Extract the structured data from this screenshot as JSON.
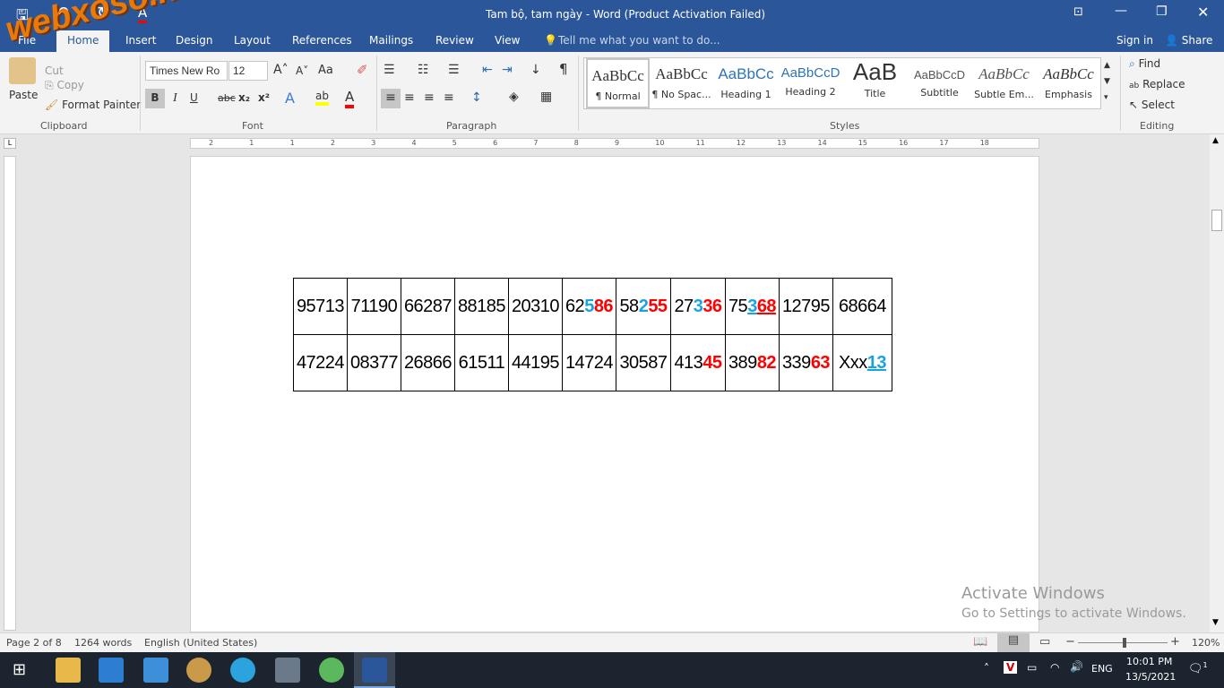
{
  "titlebar": {
    "title": "Tam bộ, tam ngày - Word (Product Activation Failed)",
    "save_icon": "save-icon",
    "undo_icon": "undo-icon",
    "redo_icon": "redo-icon"
  },
  "tabs": [
    {
      "label": "File"
    },
    {
      "label": "Home"
    },
    {
      "label": "Insert"
    },
    {
      "label": "Design"
    },
    {
      "label": "Layout"
    },
    {
      "label": "References"
    },
    {
      "label": "Mailings"
    },
    {
      "label": "Review"
    },
    {
      "label": "View"
    }
  ],
  "tell_me": "Tell me what you want to do...",
  "sign_in": "Sign in",
  "share": "Share",
  "clipboard": {
    "paste": "Paste",
    "cut": "Cut",
    "copy": "Copy",
    "format_painter": "Format Painter",
    "label": "Clipboard"
  },
  "font": {
    "name": "Times New Ro",
    "size": "12",
    "label": "Font",
    "aa": "Aa",
    "bold": "B",
    "italic": "I",
    "underline": "U",
    "strike": "abc",
    "sub": "x₂",
    "sup": "x²"
  },
  "paragraph": {
    "label": "Paragraph",
    "pilcrow": "¶"
  },
  "styles": {
    "label": "Styles",
    "items": [
      {
        "preview": "AaBbCc",
        "name": "¶ Normal"
      },
      {
        "preview": "AaBbCc",
        "name": "¶ No Spac..."
      },
      {
        "preview": "AaBbCc",
        "name": "Heading 1"
      },
      {
        "preview": "AaBbCcD",
        "name": "Heading 2"
      },
      {
        "preview": "AaB",
        "name": "Title"
      },
      {
        "preview": "AaBbCcD",
        "name": "Subtitle"
      },
      {
        "preview": "AaBbCc",
        "name": "Subtle Em..."
      },
      {
        "preview": "AaBbCc",
        "name": "Emphasis"
      }
    ]
  },
  "editing": {
    "label": "Editing",
    "find": "Find",
    "replace": "Replace",
    "select": "Select"
  },
  "ruler": {
    "marks": [
      "2",
      "1",
      "1",
      "2",
      "3",
      "4",
      "5",
      "6",
      "7",
      "8",
      "9",
      "10",
      "11",
      "12",
      "13",
      "14",
      "15",
      "16",
      "17",
      "18"
    ]
  },
  "colors": {
    "blue": "#1aa3e0",
    "red": "#ff0000",
    "accent": "#2b579a"
  },
  "table": {
    "rows": [
      [
        [
          {
            "t": "95713"
          }
        ],
        [
          {
            "t": "71190"
          }
        ],
        [
          {
            "t": "66287"
          }
        ],
        [
          {
            "t": "88185"
          }
        ],
        [
          {
            "t": "20310"
          }
        ],
        [
          {
            "t": "62"
          },
          {
            "t": "5",
            "c": "blue",
            "b": 1
          },
          {
            "t": "86",
            "c": "red",
            "b": 1
          }
        ],
        [
          {
            "t": "58"
          },
          {
            "t": "2",
            "c": "blue",
            "b": 1
          },
          {
            "t": "55",
            "c": "red",
            "b": 1
          }
        ],
        [
          {
            "t": "27"
          },
          {
            "t": "3",
            "c": "blue",
            "b": 1
          },
          {
            "t": "36",
            "c": "red",
            "b": 1
          }
        ],
        [
          {
            "t": "75"
          },
          {
            "t": "3",
            "c": "blue",
            "b": 1,
            "u": 1
          },
          {
            "t": "68",
            "c": "red",
            "b": 1,
            "u": 1
          }
        ],
        [
          {
            "t": "12795"
          }
        ],
        [
          {
            "t": "68664"
          }
        ]
      ],
      [
        [
          {
            "t": "47224"
          }
        ],
        [
          {
            "t": "08377"
          }
        ],
        [
          {
            "t": "26866"
          }
        ],
        [
          {
            "t": "61511"
          }
        ],
        [
          {
            "t": "44195"
          }
        ],
        [
          {
            "t": "14724"
          }
        ],
        [
          {
            "t": "30587"
          }
        ],
        [
          {
            "t": "413"
          },
          {
            "t": "45",
            "c": "red",
            "b": 1
          }
        ],
        [
          {
            "t": "389"
          },
          {
            "t": "82",
            "c": "red",
            "b": 1
          }
        ],
        [
          {
            "t": "339"
          },
          {
            "t": "63",
            "c": "red",
            "b": 1
          }
        ],
        [
          {
            "t": "Xxx"
          },
          {
            "t": "13",
            "c": "blue",
            "b": 1,
            "u": 1
          }
        ]
      ]
    ]
  },
  "watermark": {
    "line1": "Activate Windows",
    "line2": "Go to Settings to activate Windows."
  },
  "logo": "webxoso.net",
  "status": {
    "page": "Page 2 of 8",
    "words": "1264 words",
    "language": "English (United States)",
    "zoom": "120%",
    "zoom_percent": 120
  },
  "taskbar": {
    "lang": "ENG",
    "time": "10:01 PM",
    "date": "13/5/2021",
    "notifications": "1"
  }
}
